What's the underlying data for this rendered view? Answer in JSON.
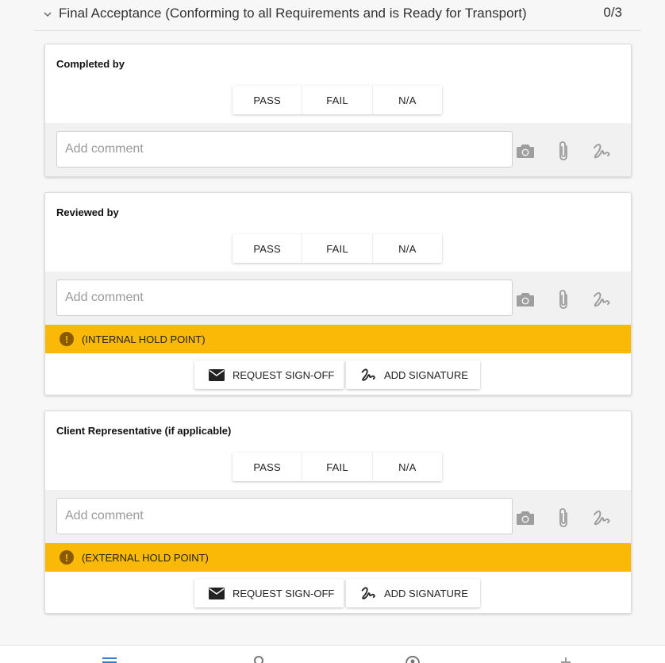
{
  "section": {
    "title": "Final Acceptance (Conforming to all Requirements and is Ready for Transport)",
    "count": "0/3"
  },
  "cards": [
    {
      "title": "Completed by",
      "options": [
        "PASS",
        "FAIL",
        "N/A"
      ],
      "comment_placeholder": "Add comment"
    },
    {
      "title": "Reviewed by",
      "options": [
        "PASS",
        "FAIL",
        "N/A"
      ],
      "comment_placeholder": "Add comment",
      "hold_point": "(INTERNAL HOLD POINT)",
      "request_label": "REQUEST SIGN-OFF",
      "signature_label": "ADD SIGNATURE"
    },
    {
      "title": "Client Representative (if applicable)",
      "options": [
        "PASS",
        "FAIL",
        "N/A"
      ],
      "comment_placeholder": "Add comment",
      "hold_point": "(EXTERNAL HOLD POINT)",
      "request_label": "REQUEST SIGN-OFF",
      "signature_label": "ADD SIGNATURE"
    }
  ],
  "icons": {
    "collapse": "chevron-down-icon",
    "camera": "camera-icon",
    "attach": "paperclip-icon",
    "sign": "signature-icon",
    "warning": "warning-icon",
    "mail": "envelope-icon",
    "nav": [
      "menu-icon",
      "search-icon",
      "sync-icon",
      "plus-icon"
    ]
  },
  "colors": {
    "hold_bar": "#fbb907",
    "nav_active": "#2f80d1",
    "icon_gray": "#9e9e9e"
  }
}
